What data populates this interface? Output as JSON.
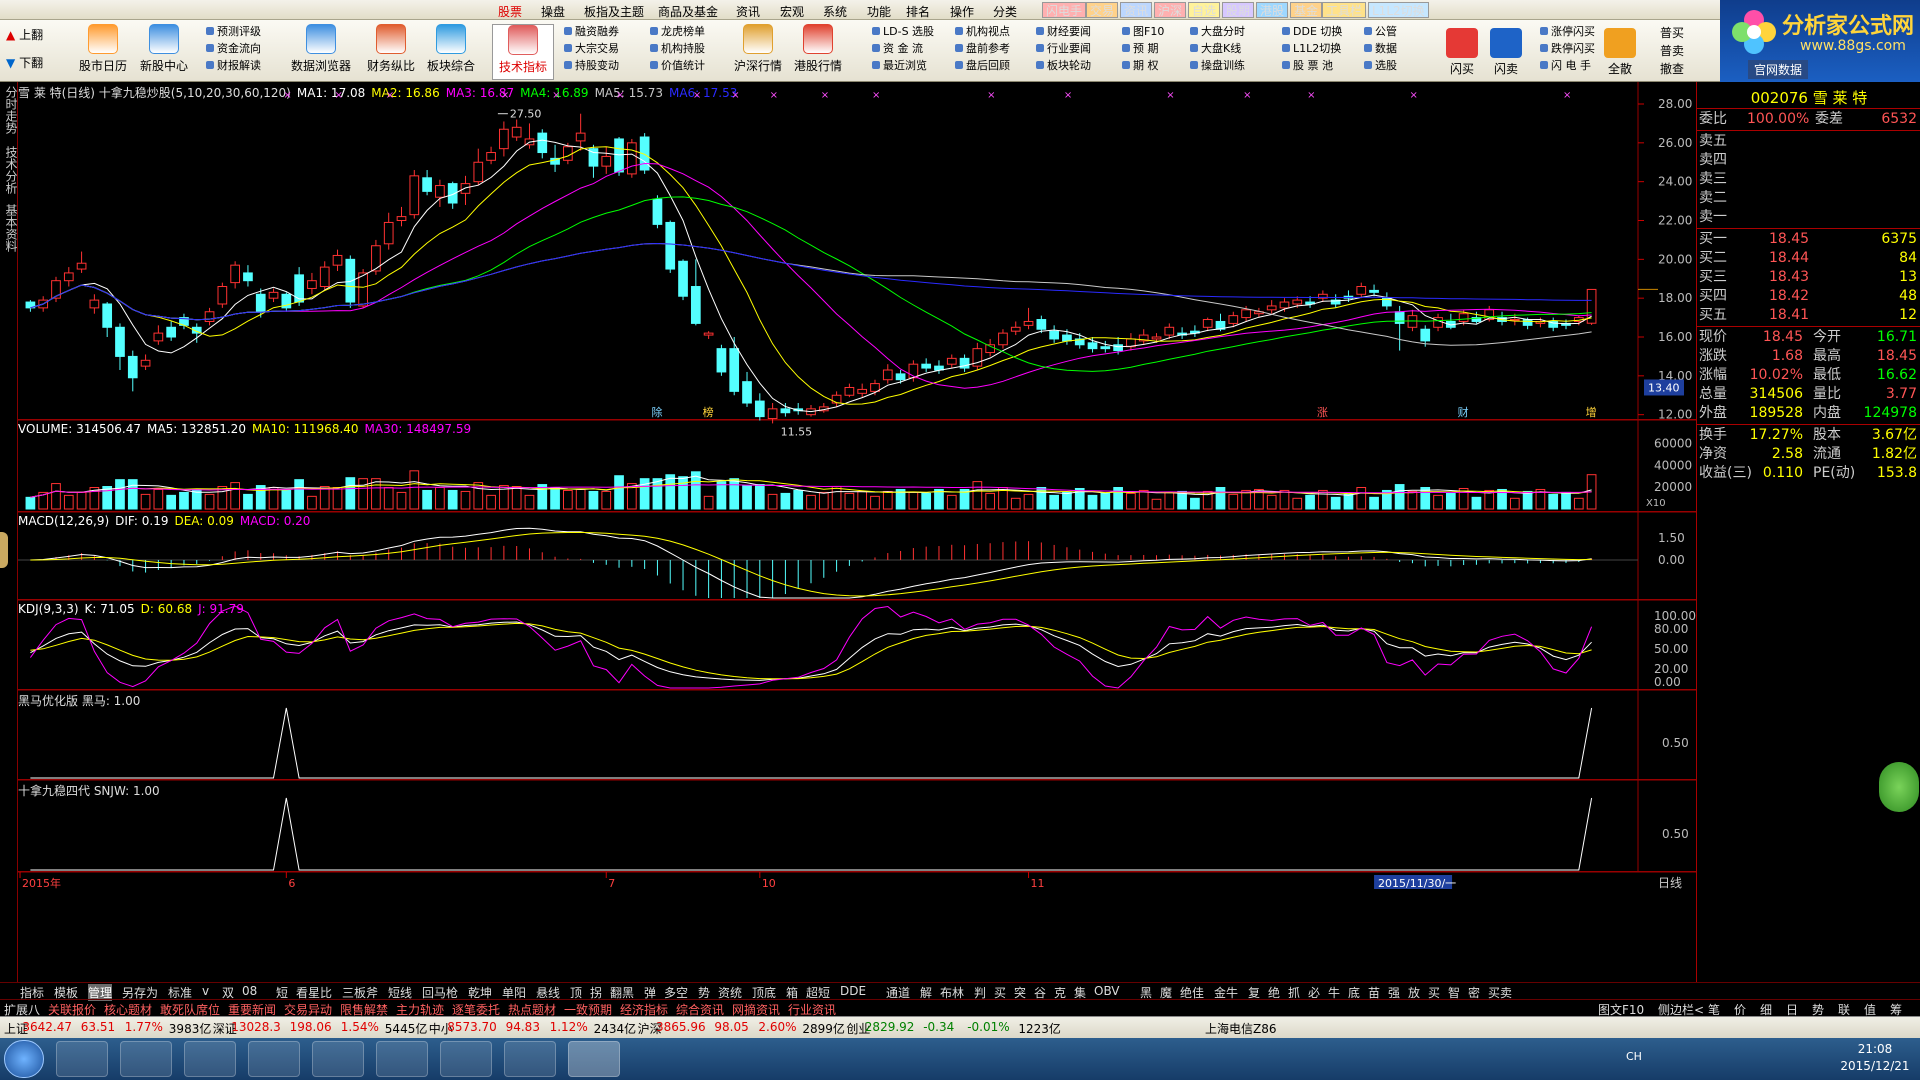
{
  "menu": {
    "items": [
      "股票",
      "操盘",
      "板指及主题",
      "商品及基金",
      "资讯",
      "宏观",
      "系统",
      "功能",
      "排名",
      "操作",
      "分类"
    ],
    "hot": [
      {
        "t": "闪电手",
        "c": "#ffb0b0"
      },
      {
        "t": "交易",
        "c": "#ffd28a"
      },
      {
        "t": "资讯",
        "c": "#bcd7ff"
      },
      {
        "t": "沪深",
        "c": "#ffb0b0"
      },
      {
        "t": "自选",
        "c": "#fff29a"
      },
      {
        "t": "股期",
        "c": "#d7c8ff"
      },
      {
        "t": "港股",
        "c": "#9ed8ff"
      },
      {
        "t": "基金",
        "c": "#ffd28a"
      },
      {
        "t": "工具栏",
        "c": "#ffe28a"
      },
      {
        "t": "L1L2切换",
        "c": "#c6e7ff"
      }
    ]
  },
  "toolbar": {
    "page_up": "上翻",
    "page_down": "下翻",
    "buttons": [
      {
        "t": "股市日历",
        "c": "#ff9b2f"
      },
      {
        "t": "新股中心",
        "c": "#3e8fe0"
      },
      {
        "t": "数据浏览器",
        "c": "#3e8fe0"
      },
      {
        "t": "财务纵比",
        "c": "#e05d2f"
      },
      {
        "t": "板块综合",
        "c": "#2f9be0"
      },
      {
        "t": "技术指标",
        "c": "#e05d5d"
      },
      {
        "t": "沪深行情",
        "c": "#e0a02f"
      },
      {
        "t": "港股行情",
        "c": "#e0422f"
      }
    ],
    "subs": [
      "预测评级",
      "资金流向",
      "财报解读",
      "融资融券",
      "大宗交易",
      "持股变动",
      "龙虎榜单",
      "机构持股",
      "价值统计",
      "LD-S 选股",
      "资 金 流",
      "最近浏览",
      "机构视点",
      "盘前参考",
      "盘后回顾",
      "财经要闻",
      "行业要闻",
      "板块轮动",
      "图F10",
      "预  期",
      "期  权",
      "大盘分时",
      "大盘K线",
      "操盘训练",
      "DDE 切换",
      "L1L2切换",
      "股 票 池",
      "公管",
      "数据",
      "选股",
      "涨停闪买",
      "跌停闪买",
      "闪 电 手"
    ],
    "right_btns": [
      "闪买",
      "闪卖",
      "全散",
      "普买",
      "普卖",
      "撤查"
    ]
  },
  "logo": {
    "title": "分析家公式网",
    "url": "www.88gs.com",
    "sub": "官网数据"
  },
  "vtabs": [
    "分时走势",
    "技术分析",
    "基本资料"
  ],
  "kline": {
    "name": "雪 莱 特(日线) 十拿九稳炒股(5,10,20,30,60,120)",
    "ma": [
      {
        "t": "MA1: 17.08",
        "c": "#ffffff"
      },
      {
        "t": "MA2: 16.86",
        "c": "#ffff00"
      },
      {
        "t": "MA3: 16.87",
        "c": "#ff00ff"
      },
      {
        "t": "MA4: 16.89",
        "c": "#00ff00"
      },
      {
        "t": "MA5: 15.73",
        "c": "#c8c8c8"
      },
      {
        "t": "MA6: 17.53",
        "c": "#2a2aff"
      }
    ],
    "yticks": [
      "28.00",
      "26.00",
      "24.00",
      "22.00",
      "20.00",
      "18.00",
      "16.00",
      "14.00",
      "12.00"
    ],
    "high_label": "27.50",
    "low_label": "11.55",
    "price_tag": "13.40",
    "events": [
      "除",
      "榜",
      "涨",
      "财",
      "增"
    ]
  },
  "volume": {
    "hdr": [
      {
        "t": "VOLUME: 314506.47",
        "c": "#ffffff"
      },
      {
        "t": "MA5: 132851.20",
        "c": "#ffffff"
      },
      {
        "t": "MA10: 111968.40",
        "c": "#ffff00"
      },
      {
        "t": "MA30: 148497.59",
        "c": "#ff00ff"
      }
    ],
    "yticks": [
      "60000",
      "40000",
      "20000"
    ],
    "unit": "X10"
  },
  "macd": {
    "hdr": [
      {
        "t": "MACD(12,26,9)",
        "c": "#ffffff"
      },
      {
        "t": "DIF: 0.19",
        "c": "#ffffff"
      },
      {
        "t": "DEA: 0.09",
        "c": "#ffff00"
      },
      {
        "t": "MACD: 0.20",
        "c": "#ff00ff"
      }
    ],
    "yticks": [
      "1.50",
      "0.00"
    ]
  },
  "kdj": {
    "hdr": [
      {
        "t": "KDJ(9,3,3)",
        "c": "#ffffff"
      },
      {
        "t": "K: 71.05",
        "c": "#ffffff"
      },
      {
        "t": "D: 60.68",
        "c": "#ffff00"
      },
      {
        "t": "J: 91.79",
        "c": "#ff00ff"
      }
    ],
    "yticks": [
      "100.00",
      "80.00",
      "50.00",
      "20.00",
      "0.00"
    ]
  },
  "heima": {
    "hdr": "黑马优化版 黑马: 1.00",
    "ytick": "0.50"
  },
  "snjw": {
    "hdr": "十拿九稳四代 SNJW: 1.00",
    "ytick": "0.50"
  },
  "timeaxis": {
    "labels": [
      "2015年",
      "6",
      "7",
      "10",
      "11"
    ],
    "cursor": "2015/11/30/一",
    "period": "日线"
  },
  "quote": {
    "code_name": "002076 雪 莱 特",
    "wb": "委比",
    "wb_v": "100.00%",
    "wc": "委差",
    "wc_v": "6532",
    "sell": [
      "卖五",
      "卖四",
      "卖三",
      "卖二",
      "卖一"
    ],
    "buy": [
      {
        "l": "买一",
        "p": "18.45",
        "v": "6375"
      },
      {
        "l": "买二",
        "p": "18.44",
        "v": "84"
      },
      {
        "l": "买三",
        "p": "18.43",
        "v": "13"
      },
      {
        "l": "买四",
        "p": "18.42",
        "v": "48"
      },
      {
        "l": "买五",
        "p": "18.41",
        "v": "12"
      }
    ],
    "stats": [
      {
        "l": "现价",
        "v": "18.45",
        "l2": "今开",
        "v2": "16.71",
        "c2": "#00ff00"
      },
      {
        "l": "涨跌",
        "v": "1.68",
        "l2": "最高",
        "v2": "18.45",
        "c2": "#ff5555"
      },
      {
        "l": "涨幅",
        "v": "10.02%",
        "l2": "最低",
        "v2": "16.62",
        "c2": "#00ff00"
      },
      {
        "l": "总量",
        "v": "314506",
        "l2": "量比",
        "v2": "3.77",
        "c2": "#ff5555"
      },
      {
        "l": "外盘",
        "v": "189528",
        "l2": "内盘",
        "v2": "124978",
        "c2": "#00ff00"
      }
    ],
    "stats2": [
      {
        "l": "换手",
        "v": "17.27%",
        "l2": "股本",
        "v2": "3.67亿"
      },
      {
        "l": "净资",
        "v": "2.58",
        "l2": "流通",
        "v2": "1.82亿"
      },
      {
        "l": "收益(三)",
        "v": "0.110",
        "l2": "PE(动)",
        "v2": "153.8"
      }
    ]
  },
  "tabs1": [
    "指标",
    "模板",
    "管理",
    "另存为",
    "标准",
    "v",
    "双",
    "08",
    "短",
    "看星比",
    "三板斧",
    "短线",
    "回马枪",
    "乾坤",
    "单阳",
    "悬线",
    "顶",
    "拐",
    "翻黑",
    "弹",
    "多空",
    "势",
    "资统",
    "顶底",
    "箱",
    "超短",
    "DDE",
    "通道",
    "解",
    "布林",
    "判",
    "买",
    "突",
    "谷",
    "克",
    "集",
    "OBV",
    "黑",
    "魔",
    "绝佳",
    "金牛",
    "复",
    "绝",
    "抓",
    "必",
    "牛",
    "底",
    "苗",
    "强",
    "放",
    "买",
    "智",
    "密",
    "买卖"
  ],
  "tabs2": [
    "扩展八",
    "关联报价",
    "核心题材",
    "敢死队席位",
    "重要新闻",
    "交易异动",
    "限售解禁",
    "主力轨迹",
    "逐笔委托",
    "热点题材",
    "一致预期",
    "经济指标",
    "综合资讯",
    "网摘资讯",
    "行业资讯"
  ],
  "tabs_right": [
    "图文F10",
    "侧边栏<",
    "笔",
    "价",
    "细",
    "日",
    "势",
    "联",
    "值",
    "筹"
  ],
  "status": [
    {
      "t": "上证",
      "c": "#000"
    },
    {
      "t": "3642.47",
      "c": "#e00000"
    },
    {
      "t": "63.51",
      "c": "#e00000"
    },
    {
      "t": "1.77%",
      "c": "#e00000"
    },
    {
      "t": "3983亿",
      "c": "#000"
    },
    {
      "t": "深证",
      "c": "#000"
    },
    {
      "t": "13028.3",
      "c": "#e00000"
    },
    {
      "t": "198.06",
      "c": "#e00000"
    },
    {
      "t": "1.54%",
      "c": "#e00000"
    },
    {
      "t": "5445亿",
      "c": "#000"
    },
    {
      "t": "中小",
      "c": "#000"
    },
    {
      "t": "8573.70",
      "c": "#e00000"
    },
    {
      "t": "94.83",
      "c": "#e00000"
    },
    {
      "t": "1.12%",
      "c": "#e00000"
    },
    {
      "t": "2434亿",
      "c": "#000"
    },
    {
      "t": "沪深",
      "c": "#000"
    },
    {
      "t": "3865.96",
      "c": "#e00000"
    },
    {
      "t": "98.05",
      "c": "#e00000"
    },
    {
      "t": "2.60%",
      "c": "#e00000"
    },
    {
      "t": "2899亿",
      "c": "#000"
    },
    {
      "t": "创业",
      "c": "#000"
    },
    {
      "t": "2829.92",
      "c": "#008000"
    },
    {
      "t": "-0.34",
      "c": "#008000"
    },
    {
      "t": "-0.01%",
      "c": "#008000"
    },
    {
      "t": "1223亿",
      "c": "#000"
    },
    {
      "t": "上海电信Z86",
      "c": "#000"
    }
  ],
  "clock": {
    "time": "21:08",
    "date": "2015/12/21",
    "lang": "CH"
  },
  "colors": {
    "up": "#ff3232",
    "down": "#54ffff",
    "grid": "#8a0000"
  },
  "chart_data": {
    "type": "candlestick",
    "title": "雪 莱 特(日线)",
    "candles": [
      [
        17.8,
        17.5,
        17.9,
        17.3
      ],
      [
        17.5,
        17.9,
        18.1,
        17.3
      ],
      [
        18.0,
        18.9,
        19.1,
        17.8
      ],
      [
        18.9,
        19.3,
        19.6,
        18.6
      ],
      [
        19.5,
        19.8,
        20.4,
        19.3
      ],
      [
        17.5,
        17.9,
        18.2,
        17.2
      ],
      [
        17.7,
        16.5,
        17.8,
        16.0
      ],
      [
        16.5,
        15.0,
        16.7,
        14.3
      ],
      [
        15.0,
        13.9,
        15.3,
        13.2
      ],
      [
        14.5,
        14.8,
        15.1,
        14.3
      ],
      [
        15.8,
        16.2,
        16.6,
        15.6
      ],
      [
        16.5,
        16.0,
        16.8,
        15.8
      ],
      [
        17.0,
        16.6,
        17.2,
        16.4
      ],
      [
        16.5,
        16.2,
        16.7,
        15.7
      ],
      [
        16.8,
        17.3,
        17.5,
        16.6
      ],
      [
        17.7,
        18.6,
        18.8,
        17.5
      ],
      [
        18.8,
        19.7,
        19.9,
        18.5
      ],
      [
        19.3,
        18.9,
        19.7,
        18.6
      ],
      [
        18.2,
        17.3,
        18.5,
        17.0
      ],
      [
        18.0,
        18.3,
        18.5,
        17.8
      ],
      [
        18.2,
        17.5,
        18.3,
        17.3
      ],
      [
        19.2,
        17.8,
        19.6,
        17.6
      ],
      [
        18.5,
        18.9,
        19.3,
        18.2
      ],
      [
        18.6,
        19.6,
        19.9,
        18.4
      ],
      [
        19.7,
        20.2,
        20.5,
        19.4
      ],
      [
        20.0,
        17.8,
        20.2,
        17.5
      ],
      [
        17.6,
        19.3,
        19.5,
        17.5
      ],
      [
        19.4,
        20.7,
        21.0,
        19.2
      ],
      [
        20.8,
        21.9,
        22.4,
        20.5
      ],
      [
        22.0,
        22.2,
        22.7,
        21.7
      ],
      [
        22.3,
        24.3,
        24.6,
        22.1
      ],
      [
        24.2,
        23.5,
        24.6,
        23.3
      ],
      [
        23.2,
        23.8,
        24.1,
        22.7
      ],
      [
        23.9,
        22.9,
        24.0,
        22.6
      ],
      [
        23.4,
        23.9,
        24.3,
        22.8
      ],
      [
        24.0,
        25.0,
        25.7,
        23.8
      ],
      [
        25.1,
        25.5,
        25.8,
        24.9
      ],
      [
        25.7,
        26.7,
        27.1,
        25.3
      ],
      [
        26.3,
        26.8,
        27.2,
        26.1
      ],
      [
        25.9,
        26.2,
        27.0,
        25.7
      ],
      [
        26.5,
        25.5,
        26.7,
        25.2
      ],
      [
        25.2,
        24.9,
        25.9,
        24.5
      ],
      [
        25.1,
        25.8,
        26.0,
        24.9
      ],
      [
        26.1,
        26.5,
        27.5,
        25.6
      ],
      [
        25.7,
        24.8,
        25.9,
        24.2
      ],
      [
        24.8,
        25.3,
        25.8,
        24.4
      ],
      [
        26.2,
        24.5,
        26.3,
        24.3
      ],
      [
        24.4,
        26.0,
        26.2,
        24.2
      ],
      [
        26.3,
        24.6,
        26.5,
        24.4
      ],
      [
        23.1,
        21.8,
        23.3,
        21.6
      ],
      [
        21.9,
        19.5,
        22.0,
        19.3
      ],
      [
        19.9,
        18.1,
        20.0,
        17.9
      ],
      [
        18.6,
        16.7,
        20.0,
        16.6
      ],
      [
        16.1,
        16.2,
        16.3,
        15.9
      ],
      [
        15.4,
        14.2,
        15.6,
        14.0
      ],
      [
        15.4,
        13.2,
        16.0,
        13.0
      ],
      [
        13.7,
        12.6,
        14.2,
        12.4
      ],
      [
        12.7,
        11.9,
        13.1,
        11.7
      ],
      [
        11.8,
        12.3,
        12.6,
        11.55
      ],
      [
        12.3,
        12.1,
        12.6,
        11.9
      ],
      [
        12.3,
        12.2,
        12.6,
        12.0
      ],
      [
        12.0,
        12.3,
        12.5,
        11.9
      ],
      [
        12.2,
        12.4,
        12.6,
        12.1
      ],
      [
        12.6,
        13.0,
        13.2,
        12.4
      ],
      [
        13.0,
        13.4,
        13.6,
        12.9
      ],
      [
        13.1,
        13.3,
        13.6,
        12.9
      ],
      [
        13.2,
        13.6,
        13.8,
        13.0
      ],
      [
        13.8,
        14.3,
        14.6,
        13.6
      ],
      [
        14.1,
        13.8,
        14.3,
        13.6
      ],
      [
        13.9,
        14.6,
        14.8,
        13.7
      ],
      [
        14.6,
        14.4,
        14.9,
        14.2
      ],
      [
        14.5,
        14.3,
        14.8,
        14.1
      ],
      [
        14.6,
        14.9,
        15.1,
        14.4
      ],
      [
        14.9,
        14.4,
        15.1,
        14.2
      ],
      [
        14.5,
        15.4,
        15.7,
        14.3
      ],
      [
        15.2,
        15.6,
        15.9,
        15.0
      ],
      [
        15.6,
        16.2,
        16.4,
        15.4
      ],
      [
        16.3,
        16.5,
        16.8,
        16.1
      ],
      [
        16.6,
        16.8,
        17.5,
        16.4
      ],
      [
        16.9,
        16.4,
        17.1,
        16.2
      ],
      [
        16.3,
        15.9,
        16.6,
        15.7
      ],
      [
        16.1,
        15.8,
        16.4,
        15.6
      ],
      [
        15.9,
        15.6,
        16.2,
        15.4
      ],
      [
        15.7,
        15.4,
        16.0,
        15.2
      ],
      [
        15.5,
        15.4,
        15.8,
        15.2
      ],
      [
        15.6,
        15.3,
        16.0,
        15.1
      ],
      [
        15.5,
        15.9,
        16.2,
        15.3
      ],
      [
        15.8,
        16.1,
        16.4,
        15.6
      ],
      [
        15.9,
        16.0,
        16.2,
        15.7
      ],
      [
        16.1,
        16.5,
        16.7,
        15.9
      ],
      [
        16.2,
        16.1,
        16.5,
        15.9
      ],
      [
        16.3,
        16.2,
        16.6,
        16.0
      ],
      [
        16.5,
        16.9,
        17.0,
        16.3
      ],
      [
        16.8,
        16.4,
        17.2,
        16.3
      ],
      [
        16.7,
        17.1,
        17.3,
        16.5
      ],
      [
        17.0,
        17.4,
        17.6,
        16.8
      ],
      [
        17.2,
        17.3,
        17.5,
        17.0
      ],
      [
        17.4,
        17.6,
        17.9,
        17.2
      ],
      [
        17.5,
        17.8,
        18.0,
        17.3
      ],
      [
        17.7,
        17.9,
        18.1,
        17.5
      ],
      [
        17.8,
        17.7,
        18.1,
        17.5
      ],
      [
        18.0,
        18.2,
        18.4,
        17.8
      ],
      [
        17.9,
        17.7,
        18.2,
        17.5
      ],
      [
        18.1,
        18.0,
        18.4,
        17.8
      ],
      [
        18.2,
        18.6,
        18.8,
        18.0
      ],
      [
        18.4,
        18.3,
        18.7,
        18.1
      ],
      [
        18.0,
        17.6,
        18.3,
        17.4
      ],
      [
        17.3,
        16.7,
        17.6,
        15.3
      ],
      [
        16.5,
        17.1,
        17.4,
        16.3
      ],
      [
        16.4,
        15.8,
        16.6,
        15.5
      ],
      [
        16.5,
        17.0,
        17.2,
        16.3
      ],
      [
        16.8,
        16.5,
        17.2,
        16.4
      ],
      [
        16.8,
        17.2,
        17.4,
        16.6
      ],
      [
        17.0,
        16.8,
        17.3,
        16.7
      ],
      [
        16.9,
        17.4,
        17.6,
        16.8
      ],
      [
        17.0,
        16.8,
        17.3,
        16.6
      ],
      [
        16.9,
        16.9,
        17.2,
        16.6
      ],
      [
        16.9,
        16.6,
        17.0,
        16.4
      ],
      [
        16.7,
        16.8,
        17.0,
        16.5
      ],
      [
        16.8,
        16.5,
        17.0,
        16.3
      ],
      [
        16.7,
        16.6,
        16.9,
        16.4
      ],
      [
        16.8,
        17.0,
        17.1,
        16.6
      ],
      [
        16.71,
        18.45,
        18.45,
        16.62
      ]
    ]
  }
}
